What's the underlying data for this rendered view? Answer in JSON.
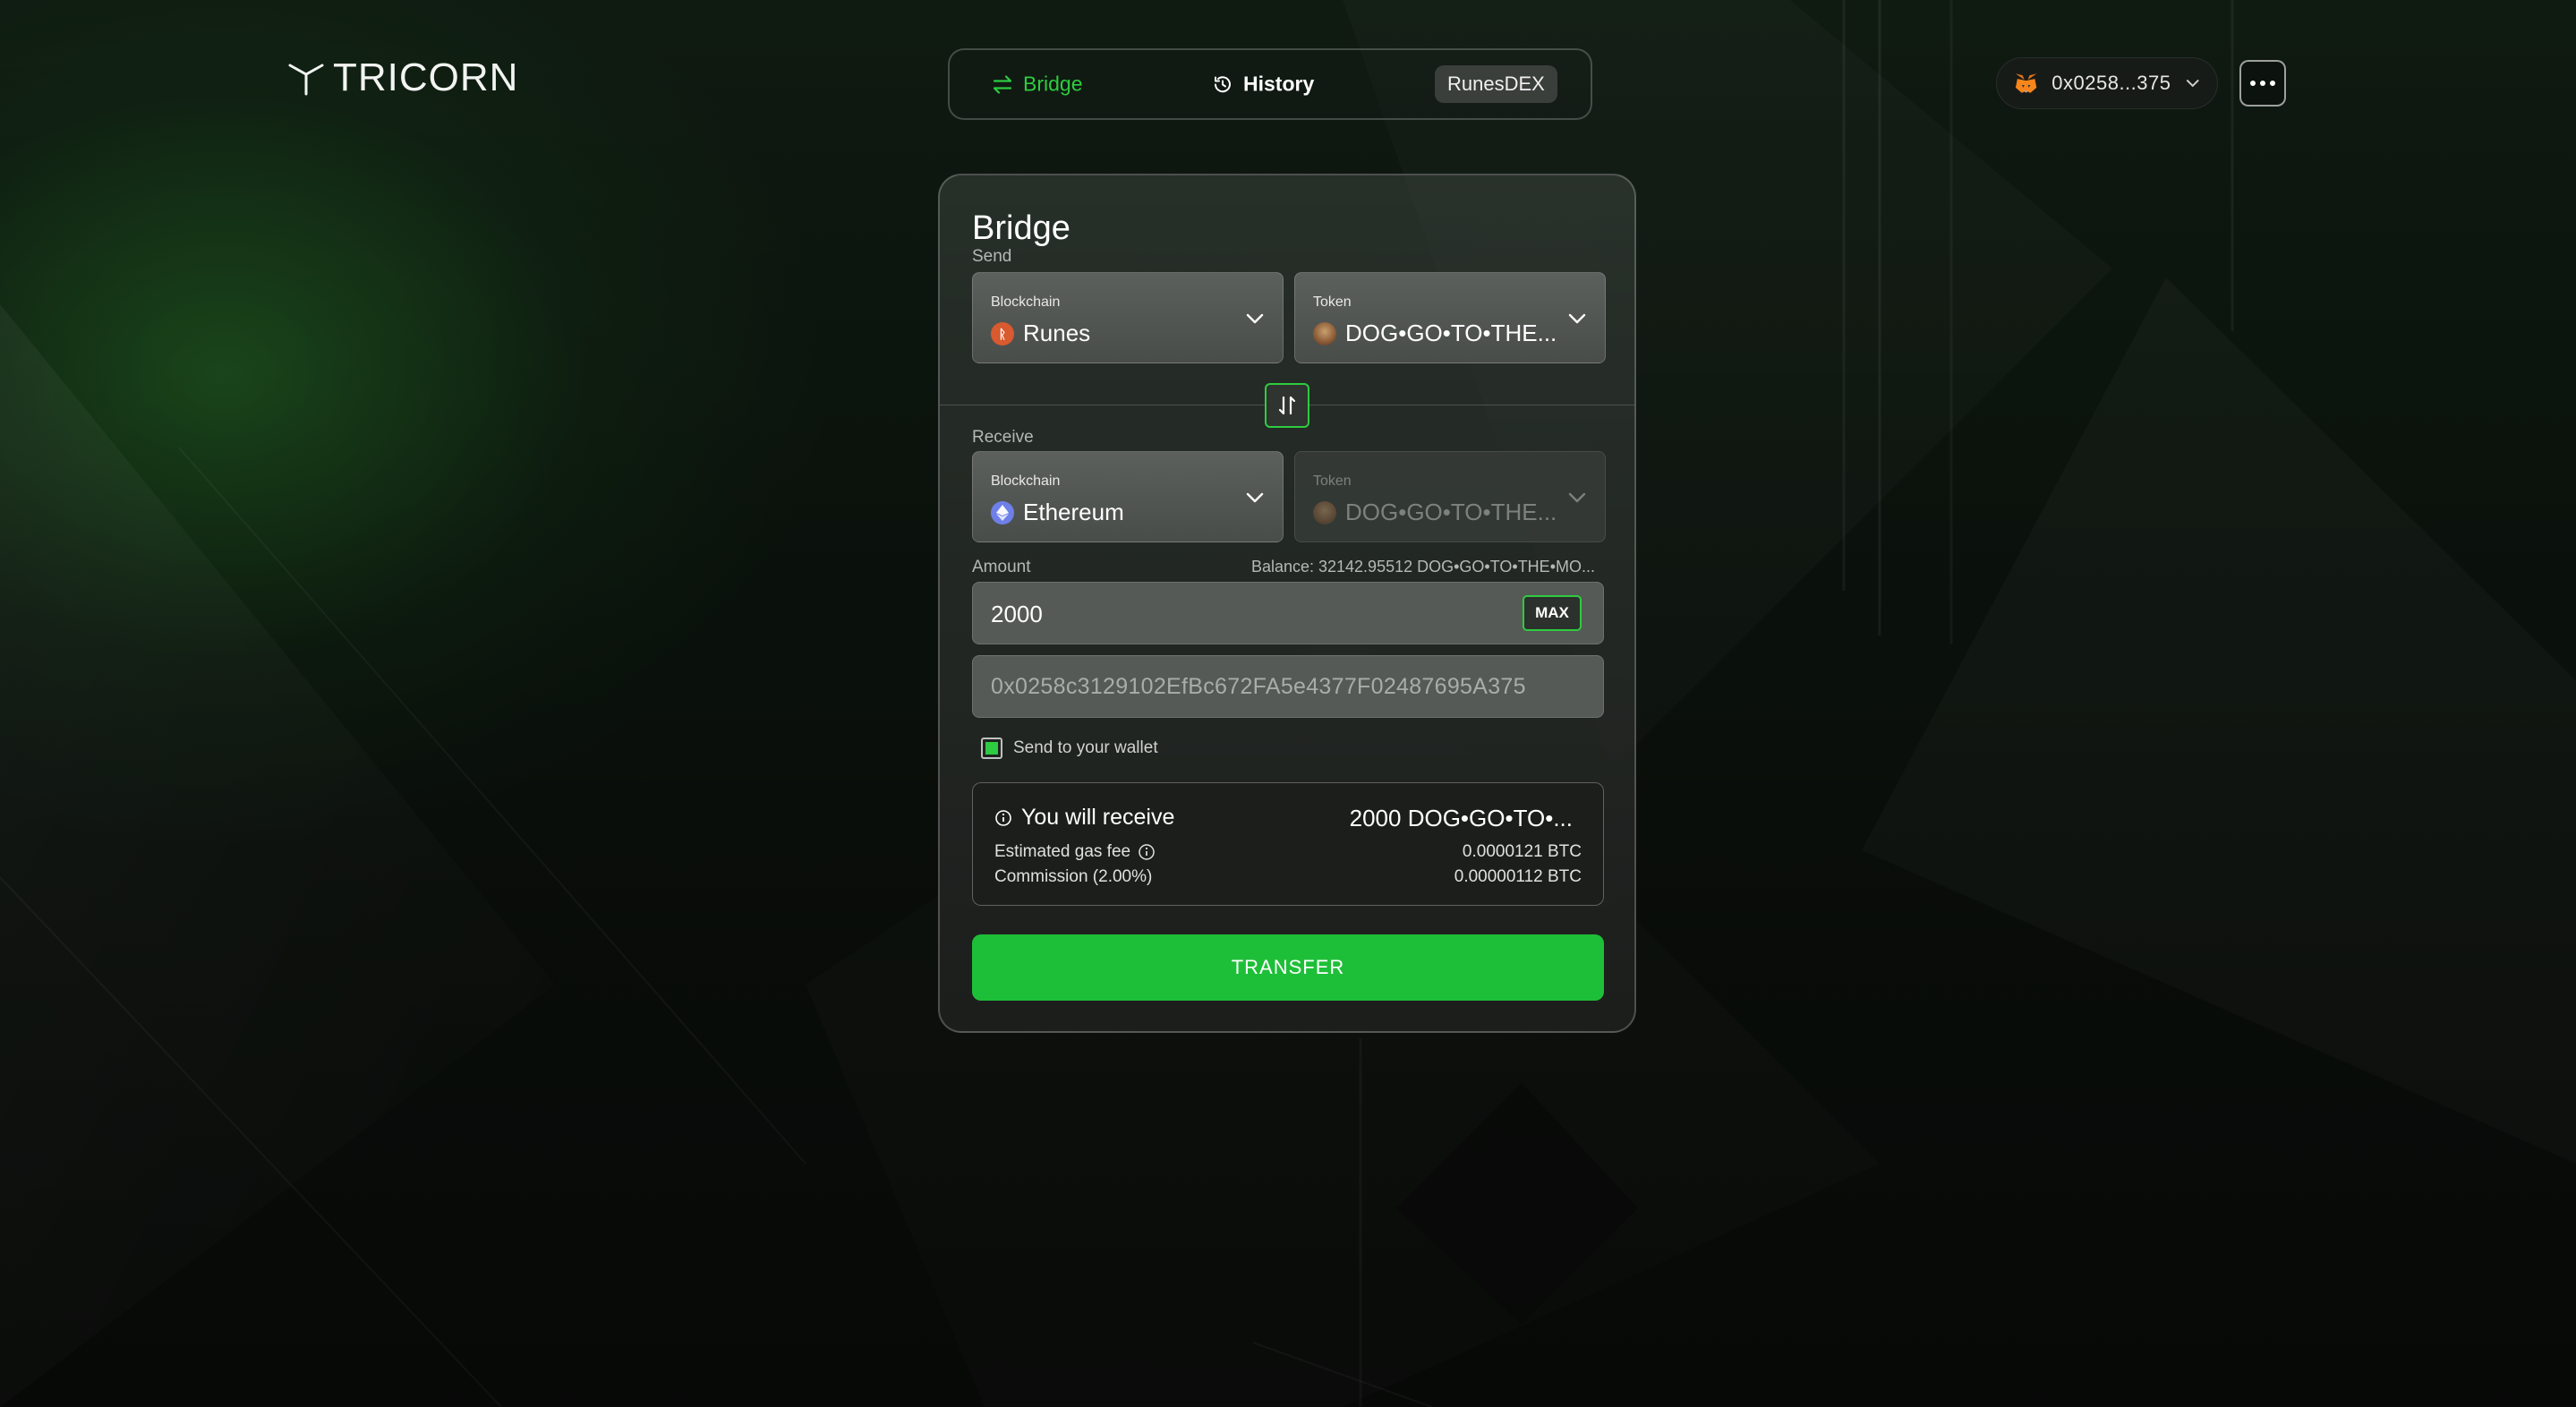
{
  "brand": {
    "name": "TRICORN"
  },
  "nav": {
    "bridge": "Bridge",
    "history": "History",
    "runesdex": "RunesDEX"
  },
  "wallet": {
    "address_short": "0x0258...375"
  },
  "card": {
    "title": "Bridge",
    "send_label": "Send",
    "send_blockchain": {
      "label": "Blockchain",
      "value": "Runes",
      "icon": "runes-coin-icon"
    },
    "send_token": {
      "label": "Token",
      "value": "DOG•GO•TO•THE...",
      "icon": "dog-token-icon"
    },
    "receive_label": "Receive",
    "receive_blockchain": {
      "label": "Blockchain",
      "value": "Ethereum",
      "icon": "ethereum-coin-icon"
    },
    "receive_token": {
      "label": "Token",
      "value": "DOG•GO•TO•THE...",
      "icon": "dog-token-icon"
    },
    "amount_label": "Amount",
    "balance_text": "Balance: 32142.95512 DOG•GO•TO•THE•MO...",
    "amount_value": "2000",
    "max_label": "MAX",
    "destination_address": "0x0258c3129102EfBc672FA5e4377F02487695A375",
    "send_to_wallet_label": "Send to your wallet",
    "send_to_wallet_checked": true,
    "summary": {
      "you_will_receive_label": "You will receive",
      "you_will_receive_value": "2000 DOG•GO•TO•...",
      "gas_fee_label": "Estimated gas fee",
      "gas_fee_value": "0.0000121 BTC",
      "commission_label": "Commission (2.00%)",
      "commission_value": "0.00000112 BTC"
    },
    "transfer_label": "TRANSFER"
  },
  "colors": {
    "accent": "#2ecc40",
    "button": "#1ebf38",
    "background": "#0c130d"
  }
}
